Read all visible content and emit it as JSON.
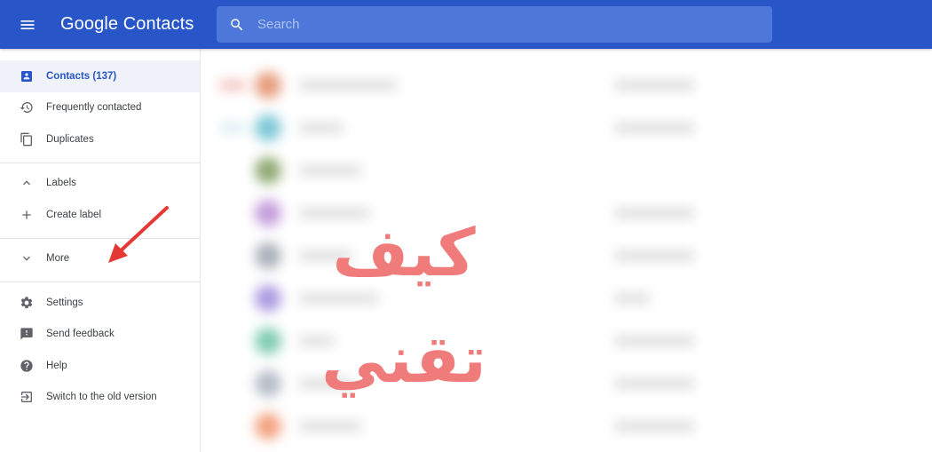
{
  "header": {
    "app_title": "Google Contacts",
    "search_placeholder": "Search"
  },
  "sidebar": {
    "items": [
      {
        "label": "Contacts (137)",
        "icon": "contacts-icon",
        "active": true
      },
      {
        "label": "Frequently contacted",
        "icon": "history-icon"
      },
      {
        "label": "Duplicates",
        "icon": "copy-icon"
      }
    ],
    "labels_section": {
      "toggle_label": "Labels",
      "toggle_icon": "chevron-up-icon",
      "create_label": "Create label",
      "create_icon": "plus-icon"
    },
    "more": {
      "label": "More",
      "icon": "chevron-down-icon"
    },
    "footer_items": [
      {
        "label": "Settings",
        "icon": "gear-icon"
      },
      {
        "label": "Send feedback",
        "icon": "feedback-icon"
      },
      {
        "label": "Help",
        "icon": "help-icon"
      },
      {
        "label": "Switch to the old version",
        "icon": "exit-icon"
      }
    ]
  },
  "watermark": {
    "text": "كيف تقني"
  },
  "colors": {
    "header_bg": "#2856c9",
    "search_bg": "#4d78d9",
    "accent": "#2856c9",
    "watermark": "#f07b7b",
    "arrow": "#e53935"
  }
}
